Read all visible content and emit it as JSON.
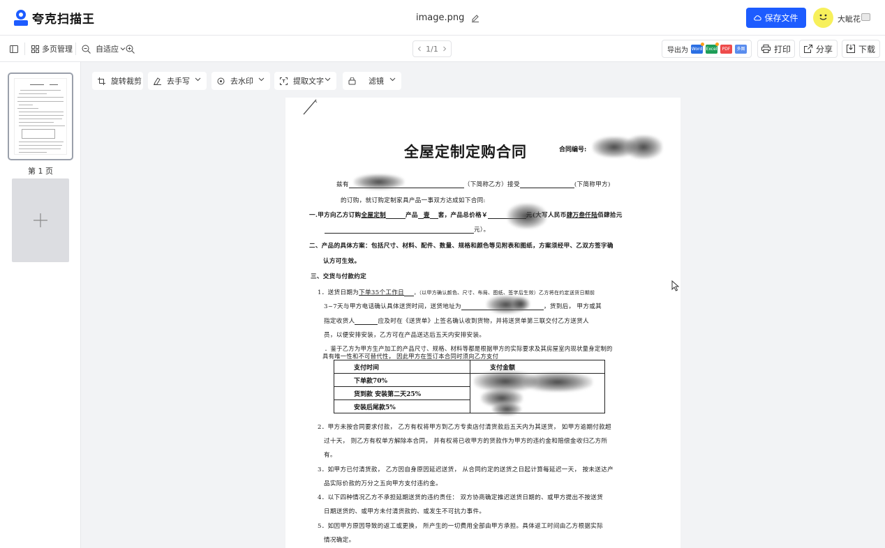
{
  "header": {
    "app_name": "夸克扫描王",
    "file_name": "image.png",
    "save_label": "保存文件",
    "username": "大眦花"
  },
  "toolbar": {
    "multi_page": "多页管理",
    "zoom": "自适应",
    "page_indicator": "1/1",
    "export_label": "导出为",
    "formats": [
      "Word",
      "Excel",
      "PDF",
      "多图"
    ],
    "print": "打印",
    "share": "分享",
    "download": "下载"
  },
  "sidebar": {
    "page_label": "第 1 页"
  },
  "tools": {
    "rotate_crop": "旋转裁剪",
    "remove_handwriting": "去手写",
    "remove_watermark": "去水印",
    "extract_text": "提取文字",
    "filter": "滤镜"
  },
  "document": {
    "title": "全屋定制定购合同",
    "contract_no": "合同编号:",
    "l1a": "兹有",
    "l1b": "（下简称乙方）接受",
    "l1c": "(下简称甲方)",
    "l2": "的订购，就订购定制家具产品一事双方达成如下合同:",
    "l3a": "一.",
    "l3b": "甲方向乙方订购",
    "l3c": "全屋定制",
    "l3d": "产品",
    "l3e": "壹",
    "l3f": "套，产品总价格￥",
    "l3g": "元(大写人民币",
    "l3h": "肆万叁仟陆",
    "l3i": "佰肆拾元",
    "l4": "元）。",
    "l5": "二、产品的具体方案：包括尺寸、材料、配件、数量、规格和颜色等见附表和图纸，方案须经甲、乙双方签字确",
    "l6": "认方可生效。",
    "l7": "三、交货与付款约定",
    "l8a": "1．送货日期为",
    "l8b": "下单35个工作日",
    "l8c": "，（以甲方确认颜色、尺寸、布局、图纸、签字后生效）乙方将在约定送货日期前",
    "l9a": "3~7天与甲方电话确认具体送货时间，送货地址为",
    "l9b": "，货到后， 甲方或其",
    "l10a": "指定收货人",
    "l10b": "应及时在《送货单》上签名确认收到货物，并将送货单第三联交付乙方送货人",
    "l11": "员，以便安排安装，乙方可在产品送达后五天内安排安装。",
    "l12": "．鉴于乙方为甲方生产加工的产品尺寸、规格、材料等都是根据甲方的实际要求及其房屋室内现状量身定制的",
    "l13": "具有唯一性和不可替代性， 因此甲方在签订本合同时须向乙方支付",
    "table": {
      "headers": [
        "支付时间",
        "支付金额"
      ],
      "rows": [
        "下单款70%",
        "货到款  安装第二天25%",
        "安装后尾款5%"
      ]
    },
    "l14": "2．甲方未按合同要求付款， 乙方有权将甲方到乙方专卖店付清货款后五天内为其送货， 如甲方逾期付款超",
    "l15": "过十天， 则乙方有权单方解除本合同， 并有权将已收甲方的货款作为甲方的违约金和赔偿金收归乙方所",
    "l16": "有。",
    "l17": "3．如甲方已付清货款， 乙方因自身原因延迟送货， 从合同约定的送货之日起计算每延迟一天， 按未送达产",
    "l18": "品实际价款的万分之五向甲方支付违约金。",
    "l19": "4．以下四种情况乙方不承担延期送货的违约责任： 双方协商确定推迟送货日期的、或甲方提出不按送货",
    "l20": "日期送货的、或甲方未付清货款的、或发生不可抗力事件。",
    "l21": "5．如因甲方原因导致的返工或更换， 所产生的一切费用全部由甲方承担。具体返工时间由乙方根据实际",
    "l22": "情况确定。"
  },
  "colors": {
    "primary": "#1d5cff",
    "word": "#2b6fe3",
    "excel": "#1e9e58",
    "pdf": "#ee4b4b",
    "multi": "#5a8dee",
    "avatar": "#f7f05b"
  }
}
